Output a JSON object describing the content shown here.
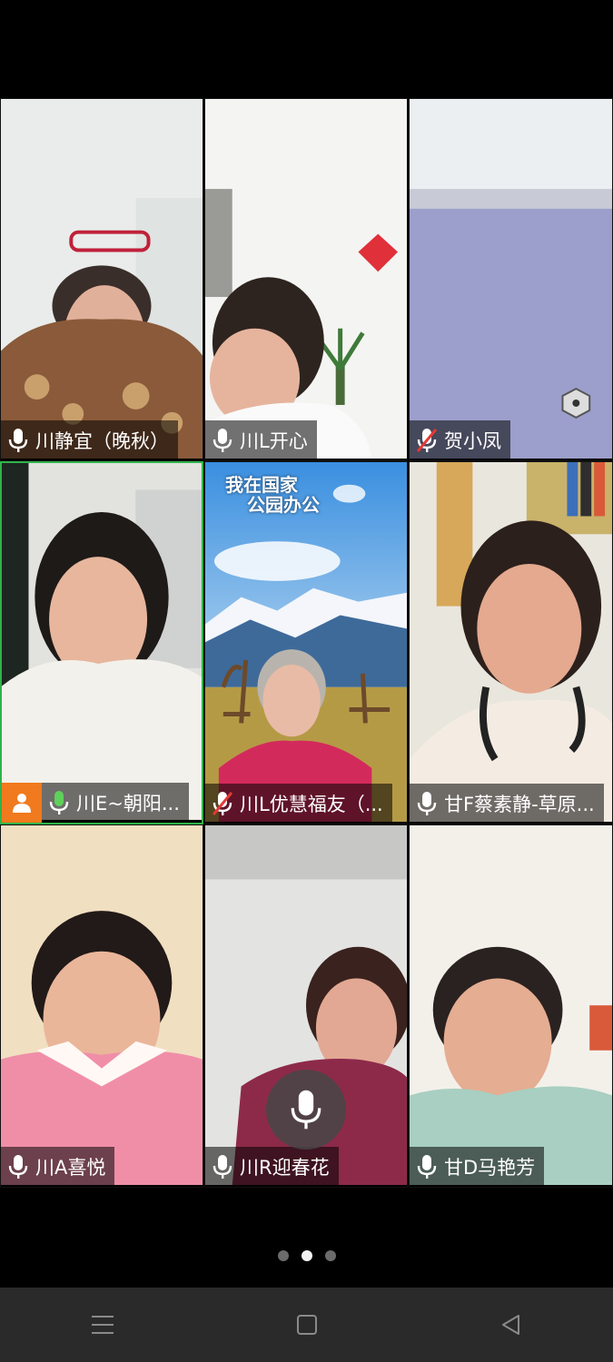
{
  "participants": [
    {
      "name": "川静宜（晚秋）",
      "muted": false,
      "host": false,
      "active": false
    },
    {
      "name": "川L开心",
      "muted": false,
      "host": false,
      "active": false
    },
    {
      "name": "贺小凤",
      "muted": true,
      "host": false,
      "active": false
    },
    {
      "name": "川E~朝阳...",
      "muted": false,
      "host": true,
      "active": true
    },
    {
      "name": "川L优慧福友（...",
      "muted": true,
      "host": false,
      "active": false
    },
    {
      "name": "甘F蔡素静-草原...",
      "muted": false,
      "host": false,
      "active": false
    },
    {
      "name": "川A喜悦",
      "muted": false,
      "host": false,
      "active": false
    },
    {
      "name": "川R迎春花",
      "muted": false,
      "host": false,
      "active": false
    },
    {
      "name": "甘D马艳芳",
      "muted": false,
      "host": false,
      "active": false
    }
  ],
  "background_banner": {
    "line1": "我在国家",
    "line2": "公园办公"
  },
  "pager": {
    "current_page": 2,
    "total_pages": 3
  },
  "colors": {
    "active_border": "#2fb34a",
    "host_badge": "#f07a1d",
    "muted_slash": "#e53935"
  },
  "icons": {
    "mic": "mic-icon",
    "muted_mic": "mic-off-icon",
    "host": "person-icon",
    "floating_mic": "mic-icon"
  }
}
